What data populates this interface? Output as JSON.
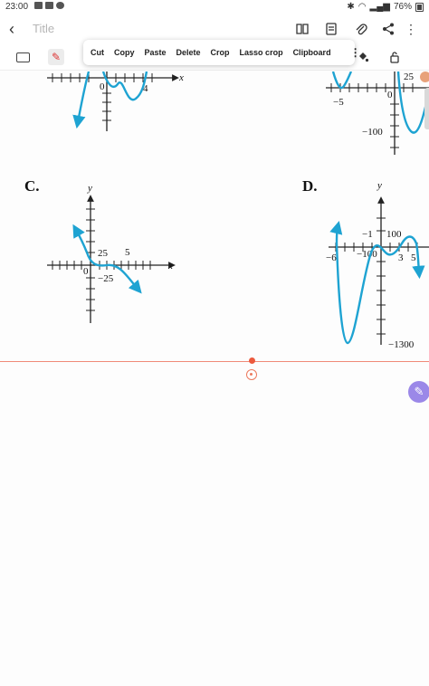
{
  "status_bar": {
    "time": "23:00",
    "battery": "76%",
    "icons": [
      "gallery-icon",
      "video-icon",
      "sync-icon",
      "bluetooth-icon",
      "wifi-icon",
      "signal-icon",
      "battery-icon"
    ]
  },
  "title_bar": {
    "title_placeholder": "Title",
    "icons": [
      "book-icon",
      "document-icon",
      "attach-icon",
      "share-icon",
      "more-vertical-icon"
    ]
  },
  "context_menu": {
    "items": [
      "Cut",
      "Copy",
      "Paste",
      "Delete",
      "Crop",
      "Lasso crop",
      "Clipboard"
    ]
  },
  "graphs": {
    "top_left": {
      "tick_labels": [
        "0",
        "4"
      ],
      "x_axis": "x"
    },
    "top_right": {
      "tick_labels": [
        "25",
        "−5",
        "0",
        "−100"
      ]
    },
    "c": {
      "letter": "C.",
      "y_axis": "y",
      "x_axis": "x",
      "tick_labels": [
        "25",
        "5",
        "0",
        "−25"
      ]
    },
    "d": {
      "letter": "D.",
      "y_axis": "y",
      "tick_labels": [
        "−1",
        "100",
        "−6",
        "−100",
        "3",
        "5",
        "−1300"
      ]
    }
  },
  "colors": {
    "curve": "#1ea3d2",
    "page_divider": "#f08a78",
    "fab": "#9b88e8"
  }
}
